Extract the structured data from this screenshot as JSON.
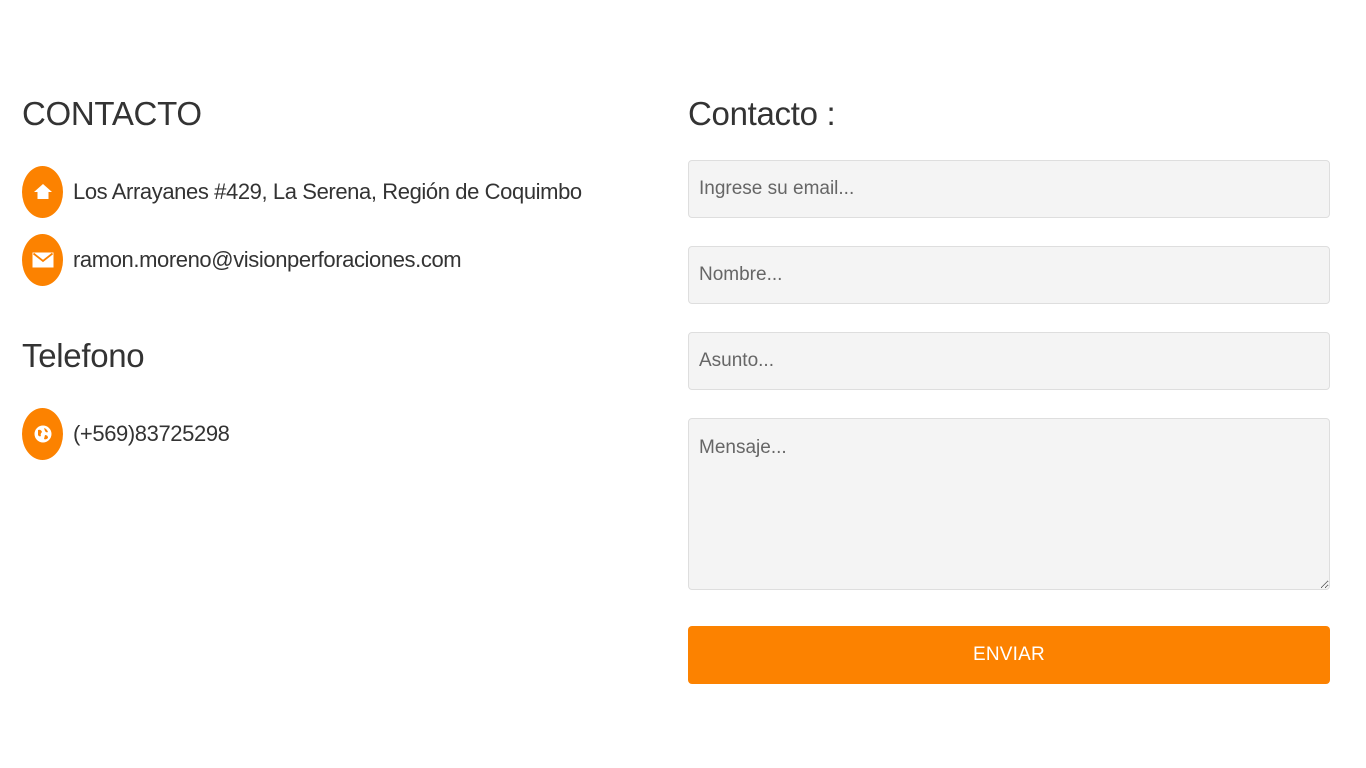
{
  "contact_info": {
    "title": "CONTACTO",
    "address": {
      "icon": "home-icon",
      "text": "Los Arrayanes #429, La Serena, Región de Coquimbo"
    },
    "email": {
      "icon": "mail-icon",
      "text": "ramon.moreno@visionperforaciones.com"
    }
  },
  "phone_section": {
    "title": "Telefono",
    "phone": {
      "icon": "globe-icon",
      "text": "(+569)83725298"
    }
  },
  "contact_form": {
    "title": "Contacto :",
    "email_placeholder": "Ingrese su email...",
    "name_placeholder": "Nombre...",
    "subject_placeholder": "Asunto...",
    "message_placeholder": "Mensaje...",
    "submit_label": "ENVIAR"
  },
  "colors": {
    "accent": "#fc8200",
    "field_background": "#f4f4f4",
    "text": "#333333"
  }
}
